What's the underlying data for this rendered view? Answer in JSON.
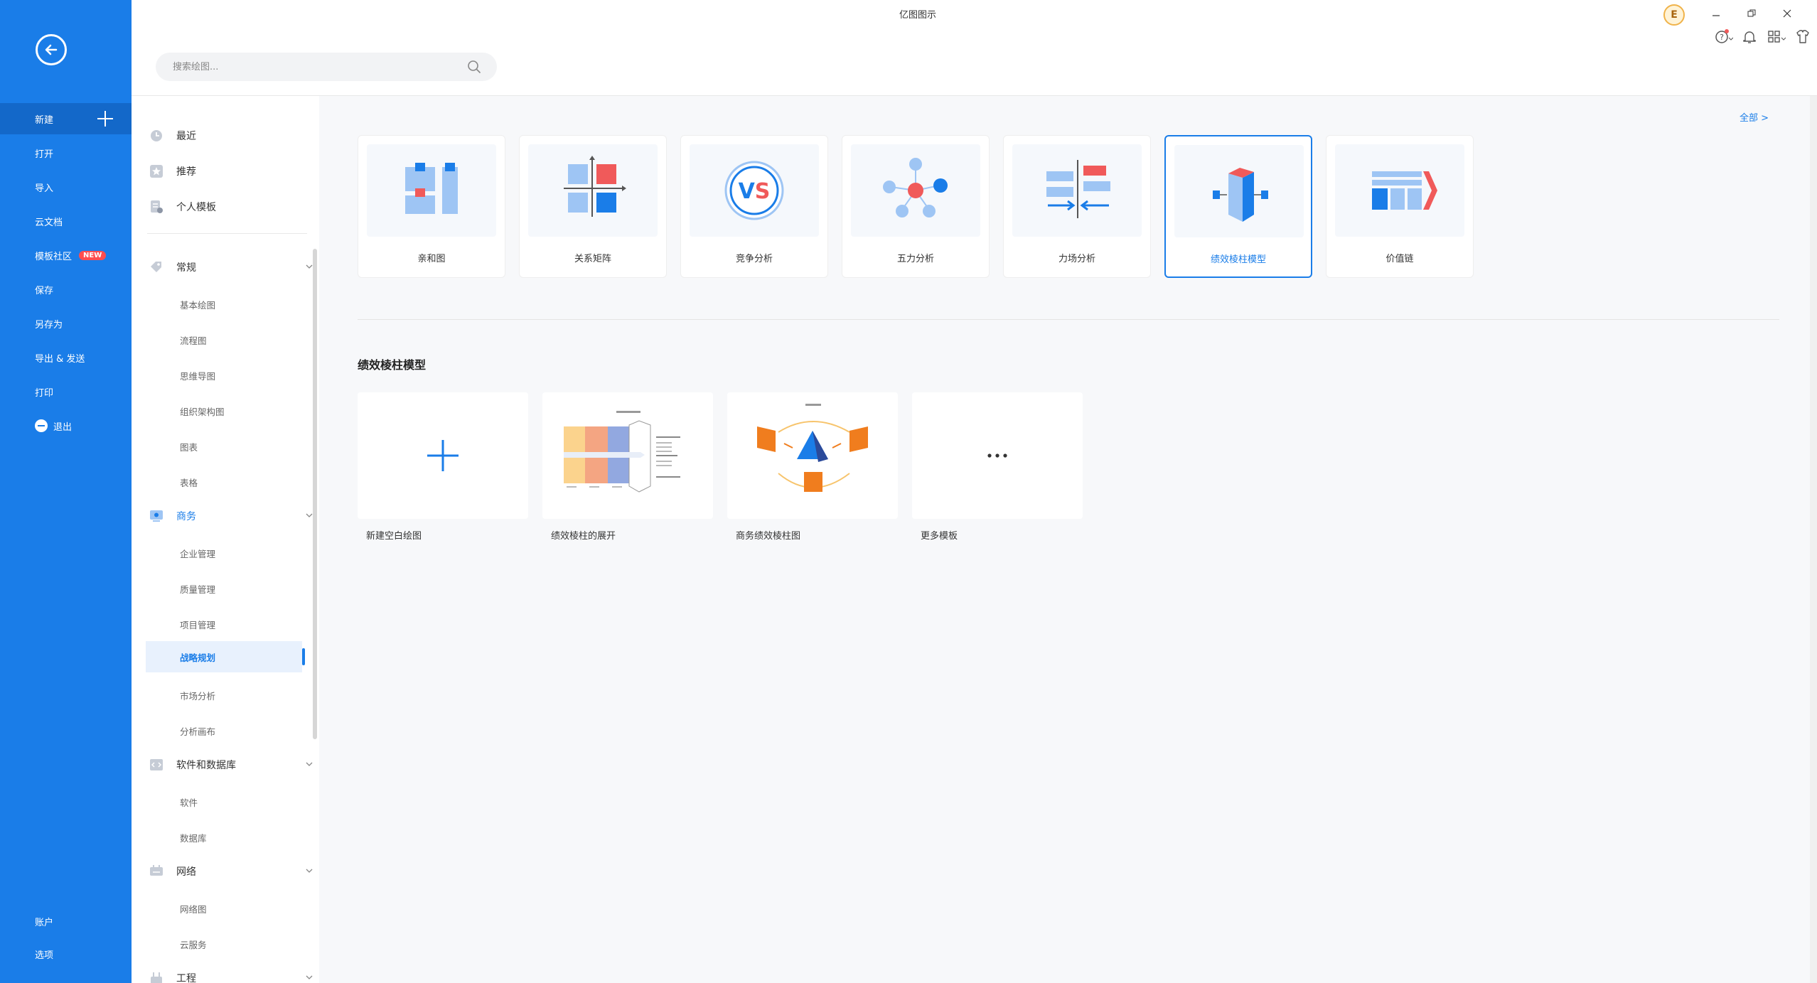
{
  "app_title": "亿图图示",
  "nav": {
    "items": [
      {
        "label": "新建"
      },
      {
        "label": "打开"
      },
      {
        "label": "导入"
      },
      {
        "label": "云文档"
      },
      {
        "label": "模板社区",
        "badge": "NEW"
      },
      {
        "label": "保存"
      },
      {
        "label": "另存为"
      },
      {
        "label": "导出 & 发送"
      },
      {
        "label": "打印"
      },
      {
        "label": "退出"
      }
    ],
    "bottom": [
      {
        "label": "账户"
      },
      {
        "label": "选项"
      }
    ]
  },
  "search": {
    "placeholder": "搜索绘图..."
  },
  "header": {
    "avatar_letter": "E"
  },
  "sidebar": {
    "top": [
      {
        "label": "最近"
      },
      {
        "label": "推荐"
      },
      {
        "label": "个人模板"
      }
    ],
    "groups": [
      {
        "label": "常规",
        "items": [
          "基本绘图",
          "流程图",
          "思维导图",
          "组织架构图",
          "图表",
          "表格"
        ]
      },
      {
        "label": "商务",
        "items": [
          "企业管理",
          "质量管理",
          "项目管理",
          "战略规划",
          "市场分析",
          "分析画布"
        ]
      },
      {
        "label": "软件和数据库",
        "items": [
          "软件",
          "数据库"
        ]
      },
      {
        "label": "网络",
        "items": [
          "网络图",
          "云服务"
        ]
      },
      {
        "label": "工程",
        "items": []
      }
    ],
    "selected": "战略规划"
  },
  "main": {
    "see_all": "全部  >",
    "categories": [
      {
        "label": "亲和图"
      },
      {
        "label": "关系矩阵"
      },
      {
        "label": "竞争分析"
      },
      {
        "label": "五力分析"
      },
      {
        "label": "力场分析"
      },
      {
        "label": "绩效棱柱模型"
      },
      {
        "label": "价值链"
      }
    ],
    "selected_category": "绩效棱柱模型",
    "section_title": "绩效棱柱模型",
    "templates": [
      {
        "label": "新建空白绘图"
      },
      {
        "label": "绩效棱柱的展开"
      },
      {
        "label": "商务绩效棱柱图"
      },
      {
        "label": "更多模板"
      }
    ]
  },
  "colors": {
    "accent": "#1a7de8",
    "nav_bg": "#1a7de8",
    "red": "#f05a5a",
    "orange": "#f07d1e"
  }
}
